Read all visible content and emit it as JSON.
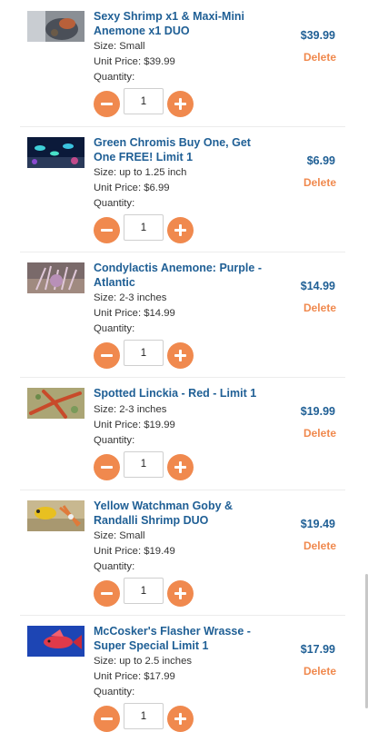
{
  "cart": {
    "items": [
      {
        "title": "Sexy Shrimp x1 & Maxi-Mini Anemone x1 DUO",
        "size": "Size: Small",
        "unit_price": "Unit Price: $39.99",
        "quantity_label": "Quantity:",
        "quantity": "1",
        "price": "$39.99",
        "delete_label": "Delete"
      },
      {
        "title": "Green Chromis Buy One, Get One FREE! Limit 1",
        "size": "Size: up to 1.25 inch",
        "unit_price": "Unit Price: $6.99",
        "quantity_label": "Quantity:",
        "quantity": "1",
        "price": "$6.99",
        "delete_label": "Delete"
      },
      {
        "title": "Condylactis Anemone: Purple - Atlantic",
        "size": "Size: 2-3 inches",
        "unit_price": "Unit Price: $14.99",
        "quantity_label": "Quantity:",
        "quantity": "1",
        "price": "$14.99",
        "delete_label": "Delete"
      },
      {
        "title": "Spotted Linckia - Red - Limit 1",
        "size": "Size: 2-3 inches",
        "unit_price": "Unit Price: $19.99",
        "quantity_label": "Quantity:",
        "quantity": "1",
        "price": "$19.99",
        "delete_label": "Delete"
      },
      {
        "title": "Yellow Watchman Goby & Randalli Shrimp DUO",
        "size": "Size: Small",
        "unit_price": "Unit Price: $19.49",
        "quantity_label": "Quantity:",
        "quantity": "1",
        "price": "$19.49",
        "delete_label": "Delete"
      },
      {
        "title": "McCosker's Flasher Wrasse - Super Special Limit 1",
        "size": "Size: up to 2.5 inches",
        "unit_price": "Unit Price: $17.99",
        "quantity_label": "Quantity:",
        "quantity": "1",
        "price": "$17.99",
        "delete_label": "Delete"
      }
    ]
  },
  "colors": {
    "title_blue": "#1f5f95",
    "accent_orange": "#f0894e",
    "text_gray": "#333333"
  },
  "icons": {
    "minus": "minus-icon",
    "plus": "plus-icon"
  }
}
